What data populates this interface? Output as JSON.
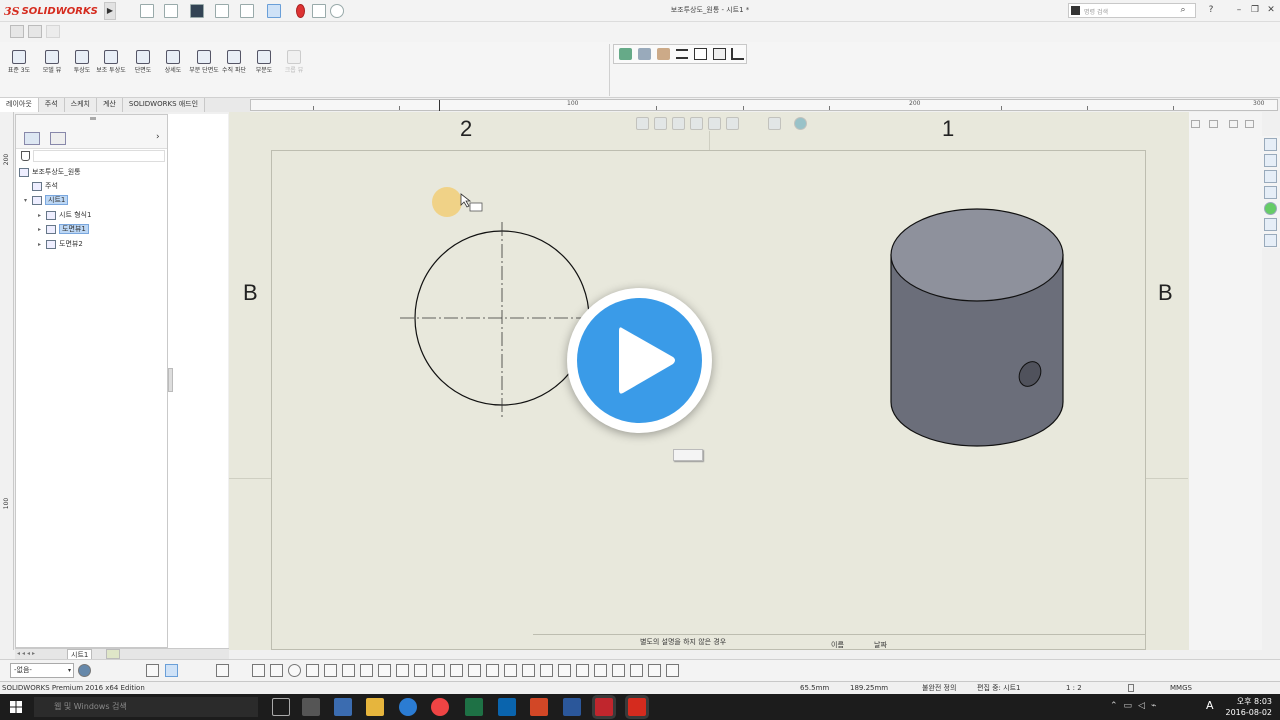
{
  "app": {
    "name": "SOLIDWORKS",
    "document_title": "보조투상도_원통 - 시트1 *",
    "search_placeholder": "명령 검색",
    "help_label": "?"
  },
  "command_manager": {
    "buttons": [
      {
        "label": "표준 3도",
        "enabled": true
      },
      {
        "label": "모델 뷰",
        "enabled": true
      },
      {
        "label": "투상도",
        "enabled": true
      },
      {
        "label": "보조 투상도",
        "enabled": true
      },
      {
        "label": "단면도",
        "enabled": true
      },
      {
        "label": "상세도",
        "enabled": true
      },
      {
        "label": "부분 단면도",
        "enabled": true
      },
      {
        "label": "수직 파단",
        "enabled": true
      },
      {
        "label": "부분도",
        "enabled": true
      },
      {
        "label": "크롭 뷰",
        "enabled": false
      }
    ]
  },
  "tabs": [
    {
      "label": "레이아웃",
      "active": true
    },
    {
      "label": "주석",
      "active": false
    },
    {
      "label": "스케치",
      "active": false
    },
    {
      "label": "계산",
      "active": false
    },
    {
      "label": "SOLIDWORKS 애드인",
      "active": false
    }
  ],
  "ruler": {
    "labels": [
      "100",
      "200",
      "300"
    ]
  },
  "vruler": {
    "labels": [
      "200",
      "100"
    ]
  },
  "feature_tree": {
    "root": "보조투상도_원통",
    "items": [
      {
        "label": "주석",
        "indent": 1,
        "selected": false,
        "expander": ""
      },
      {
        "label": "시트1",
        "indent": 1,
        "selected": true,
        "expander": "▾"
      },
      {
        "label": "시트 형식1",
        "indent": 2,
        "selected": false,
        "expander": "▸"
      },
      {
        "label": "도면뷰1",
        "indent": 2,
        "selected": true,
        "expander": "▸"
      },
      {
        "label": "도면뷰2",
        "indent": 2,
        "selected": false,
        "expander": "▸"
      }
    ]
  },
  "drawing": {
    "zone_top_left": "2",
    "zone_top_right": "1",
    "zone_left": "B",
    "zone_right": "B",
    "title_block_note": "별도의 설명을 하지 않은 경우",
    "title_block_name": "이름",
    "title_block_date": "날짜"
  },
  "sheet_tabs": {
    "active": "시트1"
  },
  "layer_select": {
    "value": "-없음-"
  },
  "status_bar": {
    "edition": "SOLIDWORKS Premium 2016 x64 Edition",
    "x": "65.5mm",
    "y": "189.25mm",
    "definition": "불완전 정의",
    "editing": "편집 중: 시트1",
    "scale": "1 : 2",
    "units": "MMGS"
  },
  "taskbar": {
    "search_placeholder": "웹 및 Windows 검색",
    "time": "오후 8:03",
    "date": "2016-08-02"
  },
  "colors": {
    "brand_red": "#d52b1e",
    "canvas": "#e8e8dc",
    "cylinder_body": "#6b6e7a",
    "cylinder_top": "#8e919c",
    "play_blue": "#3a9be8",
    "selection": "#bcd7f5"
  },
  "icons": {
    "play": "play-icon",
    "windows": "windows-icon",
    "search": "search-icon"
  }
}
